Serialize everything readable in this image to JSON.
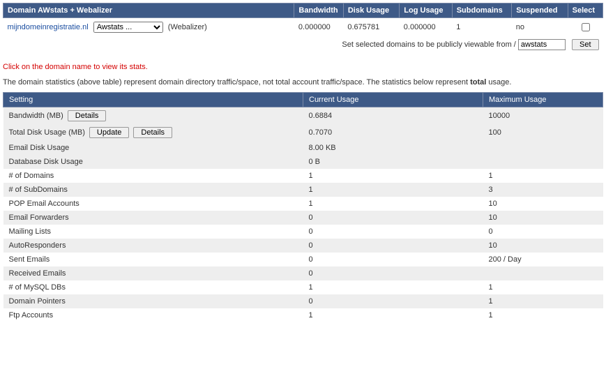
{
  "domain_table": {
    "headers": [
      "Domain AWstats + Webalizer",
      "Bandwidth",
      "Disk Usage",
      "Log Usage",
      "Subdomains",
      "Suspended",
      "Select"
    ],
    "row": {
      "domain": "mijndomeinregistratie.nl",
      "stats_select": "Awstats ...",
      "webalizer_label": "(Webalizer)",
      "bandwidth": "0.000000",
      "disk_usage": "0.675781",
      "log_usage": "0.000000",
      "subdomains": "1",
      "suspended": "no"
    }
  },
  "footer_bar": {
    "label": "Set selected domains to be publicly viewable from /",
    "input_value": "awstats",
    "set_label": "Set"
  },
  "warn_text": "Click on the domain name to view its stats.",
  "description": {
    "pre": "The domain statistics (above table) represent domain directory traffic/space, not total account traffic/space. The statistics below represent ",
    "bold": "total",
    "post": " usage."
  },
  "buttons": {
    "details": "Details",
    "update": "Update"
  },
  "stats_table": {
    "headers": [
      "Setting",
      "Current Usage",
      "Maximum Usage"
    ],
    "rows": [
      {
        "label": "Bandwidth (MB)",
        "actions": [
          "details"
        ],
        "current": "0.6884",
        "max": "10000",
        "indent": false,
        "odd": true
      },
      {
        "label": "Total Disk Usage (MB)",
        "actions": [
          "update",
          "details"
        ],
        "current": "0.7070",
        "max": "100",
        "indent": false,
        "odd": true
      },
      {
        "label": "Email Disk Usage",
        "actions": [],
        "current": "8.00 KB",
        "max": "",
        "indent": true,
        "odd": true
      },
      {
        "label": "Database Disk Usage",
        "actions": [],
        "current": "0 B",
        "max": "",
        "indent": true,
        "odd": true
      },
      {
        "label": "# of Domains",
        "actions": [],
        "current": "1",
        "max": "1",
        "indent": false,
        "odd": false
      },
      {
        "label": "# of SubDomains",
        "actions": [],
        "current": "1",
        "max": "3",
        "indent": false,
        "odd": true
      },
      {
        "label": "POP Email Accounts",
        "actions": [],
        "current": "1",
        "max": "10",
        "indent": false,
        "odd": false
      },
      {
        "label": "Email Forwarders",
        "actions": [],
        "current": "0",
        "max": "10",
        "indent": false,
        "odd": true
      },
      {
        "label": "Mailing Lists",
        "actions": [],
        "current": "0",
        "max": "0",
        "indent": false,
        "odd": false
      },
      {
        "label": "AutoResponders",
        "actions": [],
        "current": "0",
        "max": "10",
        "indent": false,
        "odd": true
      },
      {
        "label": "Sent Emails",
        "actions": [],
        "current": "0",
        "max": "200 / Day",
        "indent": false,
        "odd": false
      },
      {
        "label": "Received Emails",
        "actions": [],
        "current": "0",
        "max": "",
        "indent": false,
        "odd": true
      },
      {
        "label": "# of MySQL DBs",
        "actions": [],
        "current": "1",
        "max": "1",
        "indent": false,
        "odd": false
      },
      {
        "label": "Domain Pointers",
        "actions": [],
        "current": "0",
        "max": "1",
        "indent": false,
        "odd": true
      },
      {
        "label": "Ftp Accounts",
        "actions": [],
        "current": "1",
        "max": "1",
        "indent": false,
        "odd": false
      }
    ]
  }
}
